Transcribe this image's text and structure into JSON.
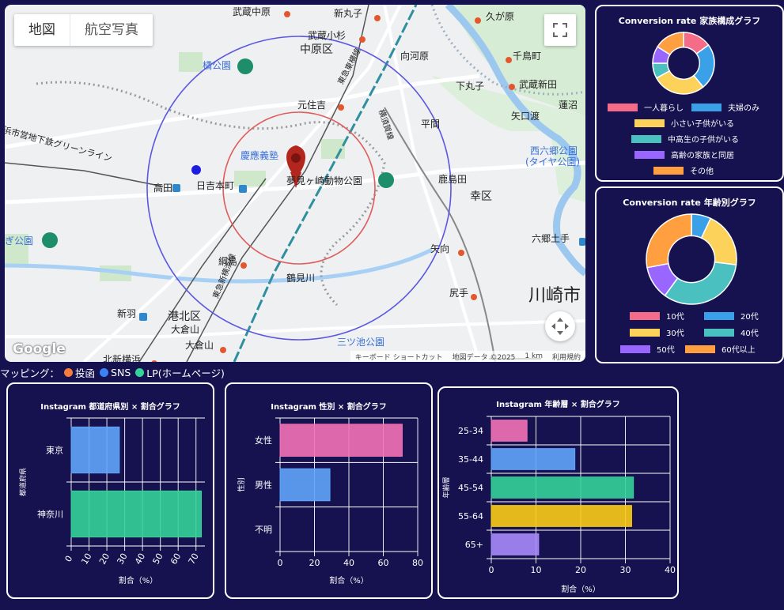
{
  "map": {
    "map_type_buttons": [
      "地図",
      "航空写真"
    ],
    "labels": [
      {
        "id": "musashi-nakahara",
        "text": "武蔵中原"
      },
      {
        "id": "shinmaruko",
        "text": "新丸子"
      },
      {
        "id": "kugahara",
        "text": "久が原"
      },
      {
        "id": "musashikosugi",
        "text": "武蔵小杉"
      },
      {
        "id": "nakahara-ku",
        "text": "中原区"
      },
      {
        "id": "mukaigawara",
        "text": "向河原"
      },
      {
        "id": "chidoricho",
        "text": "千鳥町"
      },
      {
        "id": "tachibana-park",
        "text": "橘公園"
      },
      {
        "id": "shimomaruko",
        "text": "下丸子"
      },
      {
        "id": "musashi-nitta",
        "text": "武蔵新田"
      },
      {
        "id": "motosumiyoshi",
        "text": "元住吉"
      },
      {
        "id": "yaguchinowatashi",
        "text": "矢口渡"
      },
      {
        "id": "hasunuma",
        "text": "蓮沼"
      },
      {
        "id": "hirama",
        "text": "平間"
      },
      {
        "id": "keio-univ",
        "text": "慶應義塾"
      },
      {
        "id": "nishirokugo",
        "text": "西六郷公園"
      },
      {
        "id": "tire-park",
        "text": "(タイヤ公園)"
      },
      {
        "id": "takata",
        "text": "高田"
      },
      {
        "id": "hiyoshihoncho",
        "text": "日吉本町"
      },
      {
        "id": "yumemigasaki",
        "text": "夢見ヶ崎動物公園"
      },
      {
        "id": "kashimada",
        "text": "鹿島田"
      },
      {
        "id": "saiwai-ku",
        "text": "幸区"
      },
      {
        "id": "rokugodote",
        "text": "六郷土手"
      },
      {
        "id": "tsunashima",
        "text": "綱島"
      },
      {
        "id": "shinkawasaki",
        "text": "矢向"
      },
      {
        "id": "tsurumigawa",
        "text": "鶴見川"
      },
      {
        "id": "shinyokohama-line",
        "text": "東急新横浜線"
      },
      {
        "id": "toyoko-line",
        "text": "東急東横線"
      },
      {
        "id": "nambu-line",
        "text": "横須賀線"
      },
      {
        "id": "shinohashi",
        "text": "新羽"
      },
      {
        "id": "kohoku-ku",
        "text": "港北区"
      },
      {
        "id": "okurayama1",
        "text": "大倉山"
      },
      {
        "id": "okurayama2",
        "text": "大倉山"
      },
      {
        "id": "kitashinyoko",
        "text": "北新横浜"
      },
      {
        "id": "mitsuike",
        "text": "三ツ池公園"
      },
      {
        "id": "shirite",
        "text": "尻手"
      },
      {
        "id": "kawasaki-city",
        "text": "川崎市"
      },
      {
        "id": "left-line",
        "text": "浜市営地下鉄グリーンライン"
      },
      {
        "id": "gi-park",
        "text": "ぎ公園"
      }
    ],
    "attribution": [
      "キーボード ショートカット",
      "地図データ ©2025",
      "1 km",
      "利用規約"
    ],
    "logo": "Google"
  },
  "mapping_legend": {
    "label": "マッピング：",
    "items": [
      {
        "label": "投函",
        "color": "#f57c3a"
      },
      {
        "label": "SNS",
        "color": "#3b82f6"
      },
      {
        "label": "LP(ホームページ)",
        "color": "#34d399"
      }
    ]
  },
  "family_chart": {
    "title": "Conversion rate 家族構成グラフ",
    "chart_data": {
      "type": "pie",
      "categories": [
        "一人暮らし",
        "夫婦のみ",
        "小さい子供がいる",
        "中高生の子供がいる",
        "高齢の家族と同居",
        "その他"
      ],
      "values": [
        15,
        24,
        28,
        8,
        9,
        16
      ],
      "colors": [
        "#f56c89",
        "#3aa0e8",
        "#fcd25a",
        "#4bc0c0",
        "#9966ff",
        "#ff9f40"
      ]
    }
  },
  "age_chart": {
    "title": "Conversion rate 年齢別グラフ",
    "chart_data": {
      "type": "pie",
      "categories": [
        "10代",
        "20代",
        "30代",
        "40代",
        "50代",
        "60代以上"
      ],
      "values": [
        0,
        7,
        20,
        33,
        12,
        28
      ],
      "colors": [
        "#f56c89",
        "#3aa0e8",
        "#fcd25a",
        "#4bc0c0",
        "#9966ff",
        "#ff9f40"
      ]
    }
  },
  "pref_chart": {
    "title": "Instagram 都道府県別 × 割合グラフ",
    "chart_data": {
      "type": "bar",
      "orientation": "horizontal",
      "categories": [
        "東京",
        "神奈川"
      ],
      "values": [
        27,
        73
      ],
      "colors": [
        "#60a5fa",
        "#34d399"
      ],
      "ticks": [
        0,
        10,
        20,
        30,
        40,
        50,
        60,
        70
      ],
      "xlim": [
        0,
        75
      ],
      "xlabel": "割合（%）",
      "ylabel": "都道府県"
    }
  },
  "gender_chart": {
    "title": "Instagram 性別 × 割合グラフ",
    "chart_data": {
      "type": "bar",
      "orientation": "horizontal",
      "categories": [
        "女性",
        "男性",
        "不明"
      ],
      "values": [
        71,
        29,
        0
      ],
      "colors": [
        "#f472b6",
        "#60a5fa",
        "#9ca3af"
      ],
      "ticks": [
        0,
        20,
        40,
        60,
        80
      ],
      "xlim": [
        0,
        80
      ],
      "xlabel": "割合（%）",
      "ylabel": "性別"
    }
  },
  "age_bar_chart": {
    "title": "Instagram 年齢層 × 割合グラフ",
    "chart_data": {
      "type": "bar",
      "orientation": "horizontal",
      "categories": [
        "25-34",
        "35-44",
        "45-54",
        "55-64",
        "65+"
      ],
      "values": [
        8,
        18.7,
        31.8,
        31.4,
        10.6
      ],
      "colors": [
        "#f472b6",
        "#60a5fa",
        "#34d399",
        "#facc15",
        "#a78bfa"
      ],
      "ticks": [
        0,
        10,
        20,
        30,
        40
      ],
      "xlim": [
        0,
        40
      ],
      "xlabel": "割合（%）",
      "ylabel": "年齢層"
    }
  }
}
